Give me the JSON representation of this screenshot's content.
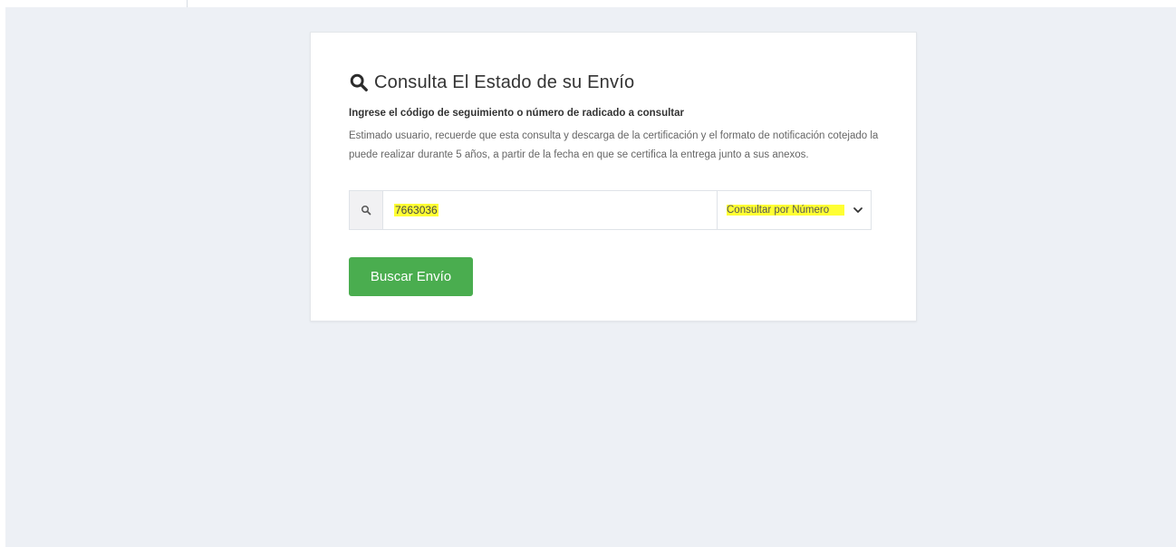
{
  "header": {
    "title": "Consulta El Estado de su Envío",
    "title_icon": "search-icon"
  },
  "form": {
    "subtitle": "Ingrese el código de seguimiento o número de radicado a consultar",
    "notice": "Estimado usuario, recuerde que esta consulta y descarga de la certificación y el formato de notificación cotejado la puede realizar durante 5 años, a partir de la fecha en que se certifica la entrega junto a sus anexos.",
    "input_icon": "search-icon",
    "input_value": "7663036",
    "select_value": "Consultar por Número",
    "select_icon": "chevron-down-icon",
    "submit_label": "Buscar Envío"
  },
  "colors": {
    "background": "#edf0f5",
    "card": "#ffffff",
    "button": "#4aad4f",
    "highlight": "#ffff33"
  }
}
